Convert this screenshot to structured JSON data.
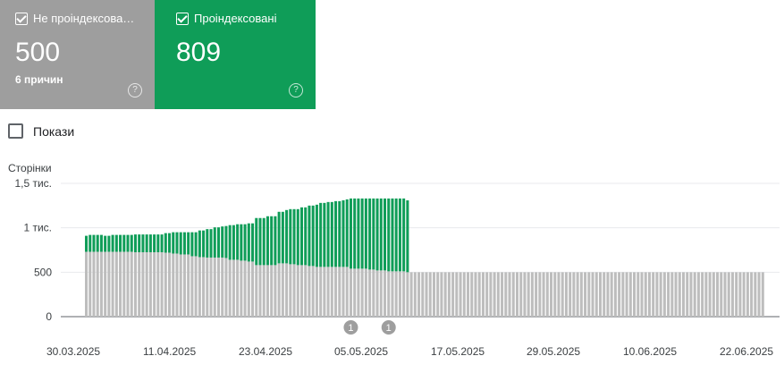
{
  "cards": {
    "not_indexed": {
      "label": "Не проіндексова…",
      "value": "500",
      "sub": "6 причин",
      "color": "#9e9e9e"
    },
    "indexed": {
      "label": "Проіндексовані",
      "value": "809",
      "color": "#0f9d58"
    }
  },
  "help_symbol": "?",
  "show_toggle": {
    "label": "Покази",
    "checked": false
  },
  "chart_data": {
    "type": "bar",
    "stacked": true,
    "ylabel": "Сторінки",
    "y_ticks": [
      {
        "value": 0,
        "label": "0"
      },
      {
        "value": 500,
        "label": "500"
      },
      {
        "value": 1000,
        "label": "1 тис."
      },
      {
        "value": 1500,
        "label": "1,5 тис."
      }
    ],
    "ylim": [
      0,
      1500
    ],
    "grid": true,
    "x_tick_labels": [
      "30.03.2025",
      "11.04.2025",
      "23.04.2025",
      "05.05.2025",
      "17.05.2025",
      "29.05.2025",
      "10.06.2025",
      "22.06.2025"
    ],
    "annotations": [
      {
        "bar_index": 70,
        "label": "1"
      },
      {
        "bar_index": 80,
        "label": "1"
      }
    ],
    "series": [
      {
        "name": "Не проіндексовані",
        "color": "#bdbdbd",
        "values": [
          730,
          730,
          730,
          730,
          730,
          730,
          730,
          730,
          730,
          730,
          730,
          730,
          730,
          725,
          725,
          725,
          725,
          725,
          725,
          725,
          725,
          720,
          720,
          710,
          710,
          700,
          700,
          700,
          680,
          680,
          670,
          670,
          665,
          665,
          665,
          665,
          665,
          660,
          640,
          640,
          640,
          630,
          630,
          620,
          620,
          580,
          580,
          580,
          580,
          580,
          580,
          600,
          600,
          600,
          590,
          590,
          580,
          580,
          580,
          570,
          570,
          560,
          560,
          560,
          560,
          560,
          560,
          560,
          560,
          560,
          540,
          540,
          540,
          540,
          540,
          530,
          530,
          520,
          520,
          520,
          510,
          510,
          510,
          510,
          510,
          500,
          500,
          500,
          500,
          500,
          500,
          500,
          500,
          500,
          500,
          500,
          500,
          500,
          500,
          500,
          500,
          500,
          500,
          500,
          500,
          500,
          500,
          500,
          500,
          500,
          500,
          500,
          500,
          500,
          500,
          500,
          500,
          500,
          500,
          500,
          500,
          500,
          500,
          500,
          500,
          500,
          500,
          500,
          500,
          500,
          500,
          500,
          500,
          500,
          500,
          500,
          500,
          500,
          500,
          500,
          500,
          500,
          500,
          500,
          500,
          500,
          500,
          500,
          500,
          500,
          500,
          500,
          500,
          500,
          500,
          500,
          500,
          500,
          500,
          500,
          500,
          500,
          500,
          500,
          500,
          500,
          500,
          500,
          500,
          500,
          500,
          500,
          500,
          500,
          500,
          500,
          500,
          500,
          500,
          500
        ]
      },
      {
        "name": "Проіндексовані",
        "color": "#0f9d58",
        "values": [
          180,
          190,
          190,
          190,
          190,
          180,
          180,
          190,
          190,
          190,
          190,
          190,
          190,
          200,
          200,
          200,
          200,
          200,
          200,
          200,
          200,
          220,
          220,
          240,
          240,
          250,
          250,
          250,
          270,
          270,
          300,
          300,
          320,
          320,
          340,
          340,
          350,
          360,
          390,
          390,
          400,
          410,
          410,
          430,
          430,
          530,
          530,
          530,
          550,
          550,
          550,
          580,
          580,
          600,
          620,
          620,
          630,
          650,
          650,
          680,
          680,
          700,
          720,
          720,
          730,
          730,
          740,
          740,
          750,
          760,
          790,
          790,
          790,
          790,
          790,
          800,
          800,
          810,
          810,
          810,
          820,
          820,
          820,
          820,
          820,
          809
        ]
      }
    ]
  }
}
